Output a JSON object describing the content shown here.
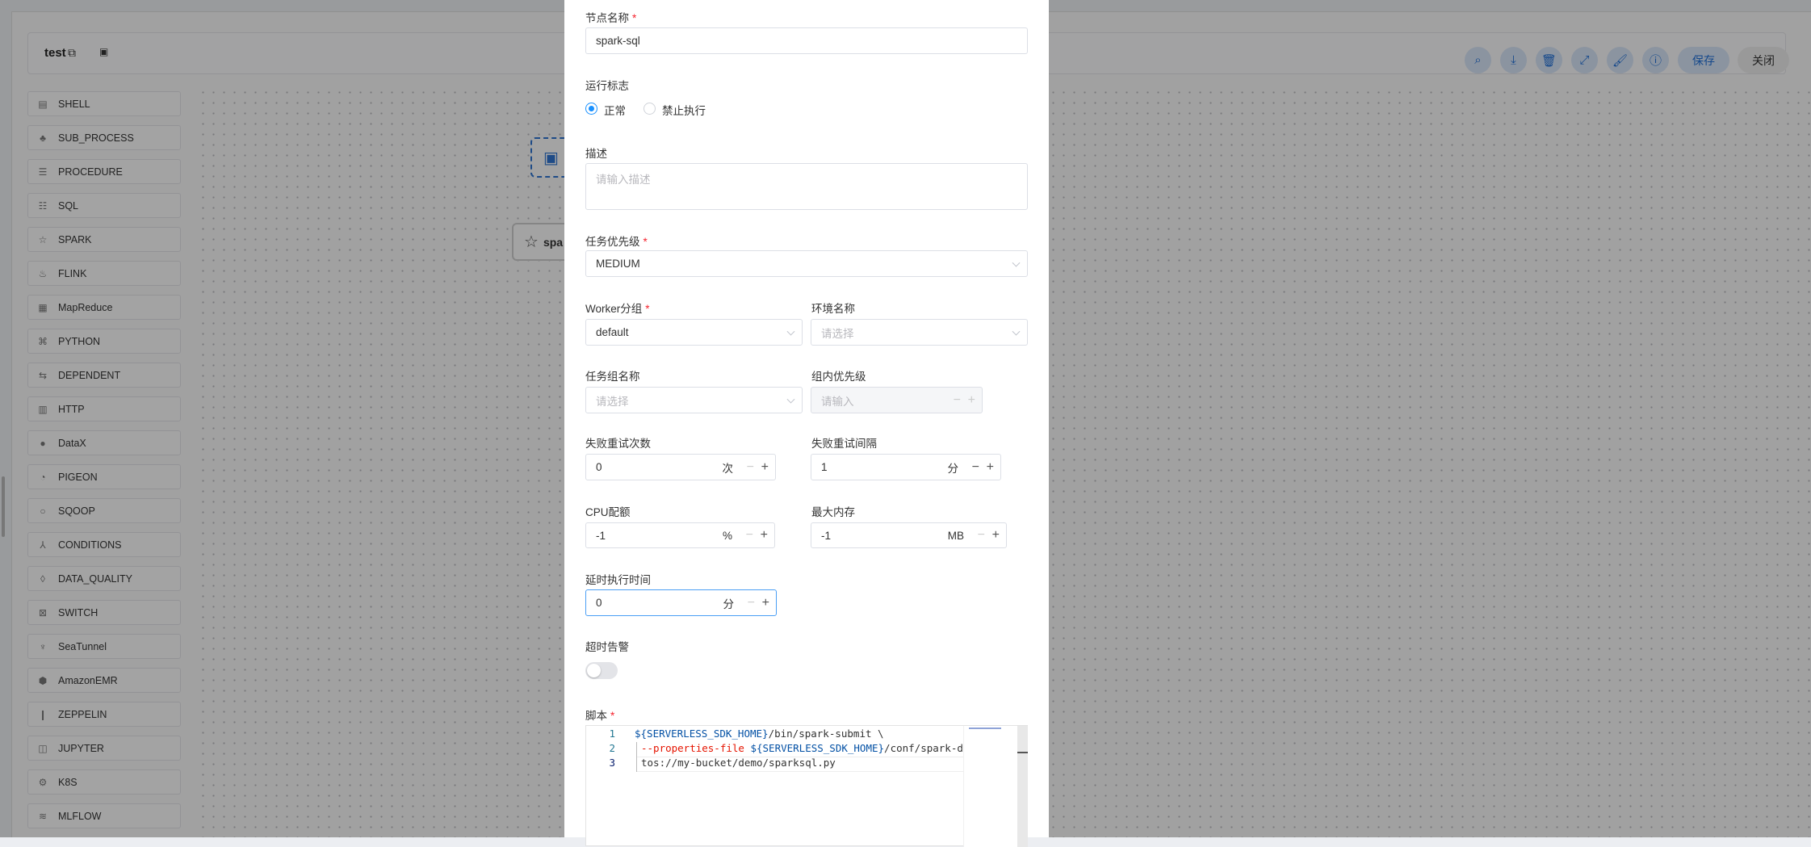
{
  "toolbar": {
    "title": "test",
    "save_label": "保存",
    "close_label": "关闭",
    "icons": [
      "search-icon",
      "download-icon",
      "delete-icon",
      "fullscreen-icon",
      "format-icon",
      "info-icon"
    ]
  },
  "sidebar": {
    "items": [
      "SHELL",
      "SUB_PROCESS",
      "PROCEDURE",
      "SQL",
      "SPARK",
      "FLINK",
      "MapReduce",
      "PYTHON",
      "DEPENDENT",
      "HTTP",
      "DataX",
      "PIGEON",
      "SQOOP",
      "CONDITIONS",
      "DATA_QUALITY",
      "SWITCH",
      "SeaTunnel",
      "AmazonEMR",
      "ZEPPELIN",
      "JUPYTER",
      "K8S",
      "MLFLOW"
    ]
  },
  "canvas": {
    "spark_node_label": "spa"
  },
  "form": {
    "node_name": {
      "label": "节点名称",
      "value": "spark-sql"
    },
    "run_flag": {
      "label": "运行标志",
      "options": [
        "正常",
        "禁止执行"
      ],
      "selected": "正常"
    },
    "description": {
      "label": "描述",
      "placeholder": "请输入描述"
    },
    "priority": {
      "label": "任务优先级",
      "value": "MEDIUM"
    },
    "worker_group": {
      "label": "Worker分组",
      "value": "default"
    },
    "environment": {
      "label": "环境名称",
      "placeholder": "请选择"
    },
    "task_group": {
      "label": "任务组名称",
      "placeholder": "请选择"
    },
    "group_priority": {
      "label": "组内优先级",
      "placeholder": "请输入"
    },
    "retry_times": {
      "label": "失败重试次数",
      "value": "0",
      "suffix": "次"
    },
    "retry_interval": {
      "label": "失败重试间隔",
      "value": "1",
      "suffix": "分"
    },
    "cpu_quota": {
      "label": "CPU配额",
      "value": "-1",
      "suffix": "%"
    },
    "max_memory": {
      "label": "最大内存",
      "value": "-1",
      "suffix": "MB"
    },
    "delay_time": {
      "label": "延时执行时间",
      "value": "0",
      "suffix": "分"
    },
    "timeout_alarm": {
      "label": "超时告警",
      "enabled": false
    },
    "script": {
      "label": "脚本",
      "lines": [
        {
          "n": "1",
          "a": "${SERVERLESS_SDK_HOME}",
          "b": "/bin/spark-submit \\"
        },
        {
          "n": "2",
          "a": "--properties-file",
          "b": "${SERVERLESS_SDK_HOME}",
          "c": "/conf/spark-defa"
        },
        {
          "n": "3",
          "a": "tos://my-bucket/demo/sparksql.py"
        }
      ]
    }
  },
  "colors": {
    "primary": "#1890ff",
    "required": "#f5222d"
  }
}
